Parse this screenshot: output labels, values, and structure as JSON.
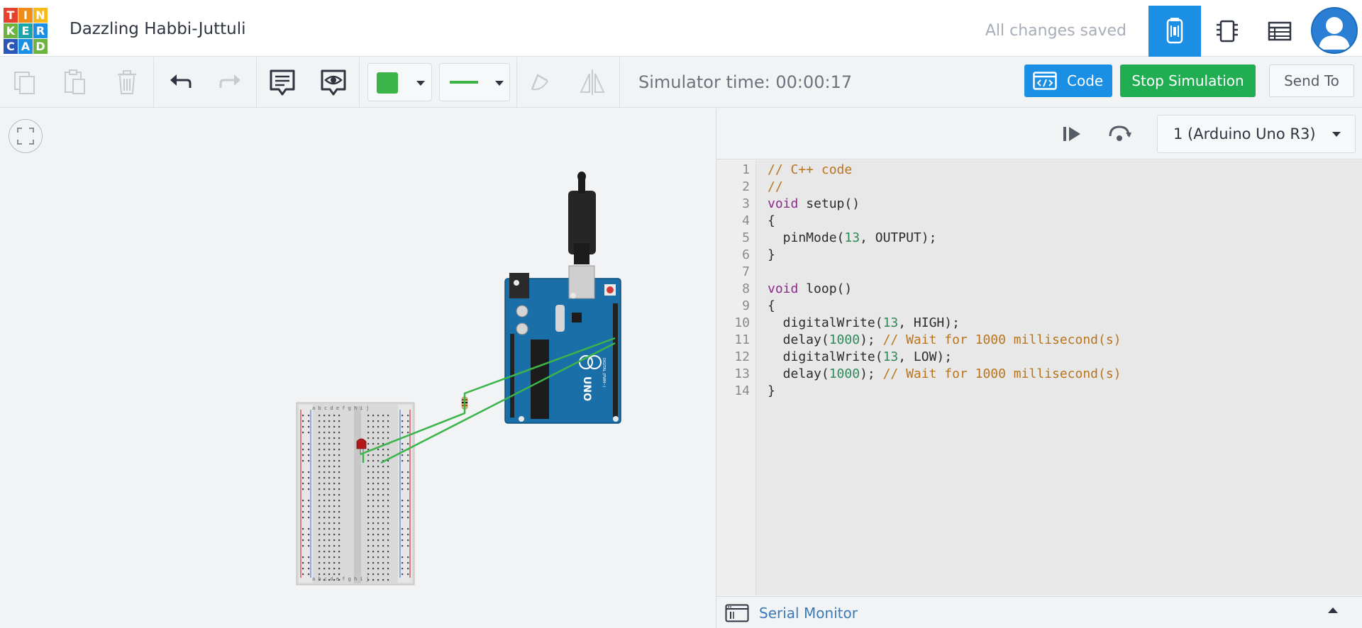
{
  "header": {
    "logo_letters": [
      "T",
      "I",
      "N",
      "K",
      "E",
      "R",
      "C",
      "A",
      "D"
    ],
    "logo_colors": [
      "#e8402f",
      "#f08c1a",
      "#f5b91b",
      "#6cb33f",
      "#1ba5a8",
      "#1a8fe3",
      "#2a57b8",
      "#1a8fe3",
      "#6cb33f"
    ],
    "project_title": "Dazzling Habbi-Juttuli",
    "save_status": "All changes saved",
    "views": [
      {
        "name": "circuit-view",
        "icon": "breadboard-icon",
        "active": true
      },
      {
        "name": "component-list",
        "icon": "chip-icon",
        "active": false
      },
      {
        "name": "table-view",
        "icon": "table-icon",
        "active": false
      }
    ],
    "avatar_icon": "user-avatar-icon"
  },
  "toolbar": {
    "tools": [
      "copy-icon",
      "paste-icon",
      "delete-icon",
      "undo-icon",
      "redo-icon",
      "notes-icon",
      "view-icon",
      "rotate-icon",
      "flip-icon"
    ],
    "wire_color": "#3bb54a",
    "simulator_time": "Simulator time: 00:00:17",
    "code_label": "Code",
    "stop_label": "Stop Simulation",
    "send_label": "Send To",
    "accent": "#1a8fe3",
    "stop_color": "#21ad52"
  },
  "code_panel": {
    "device": "1 (Arduino Uno R3)",
    "serial_monitor_label": "Serial Monitor",
    "code_lines": [
      "// C++ code",
      "//",
      "void setup()",
      "{",
      "  pinMode(13, OUTPUT);",
      "}",
      "",
      "void loop()",
      "{",
      "  digitalWrite(13, HIGH);",
      "  delay(1000); // Wait for 1000 millisecond(s)",
      "  digitalWrite(13, LOW);",
      "  delay(1000); // Wait for 1000 millisecond(s)",
      "}"
    ]
  },
  "workplane": {
    "fit_icon": "fit-view-icon",
    "board": {
      "name": "Arduino Uno R3",
      "logo_text": "UNO",
      "label_text": "DIGITAL (PWM~)"
    },
    "breadboard_column_letters": "a b c d e   f g h i j"
  }
}
